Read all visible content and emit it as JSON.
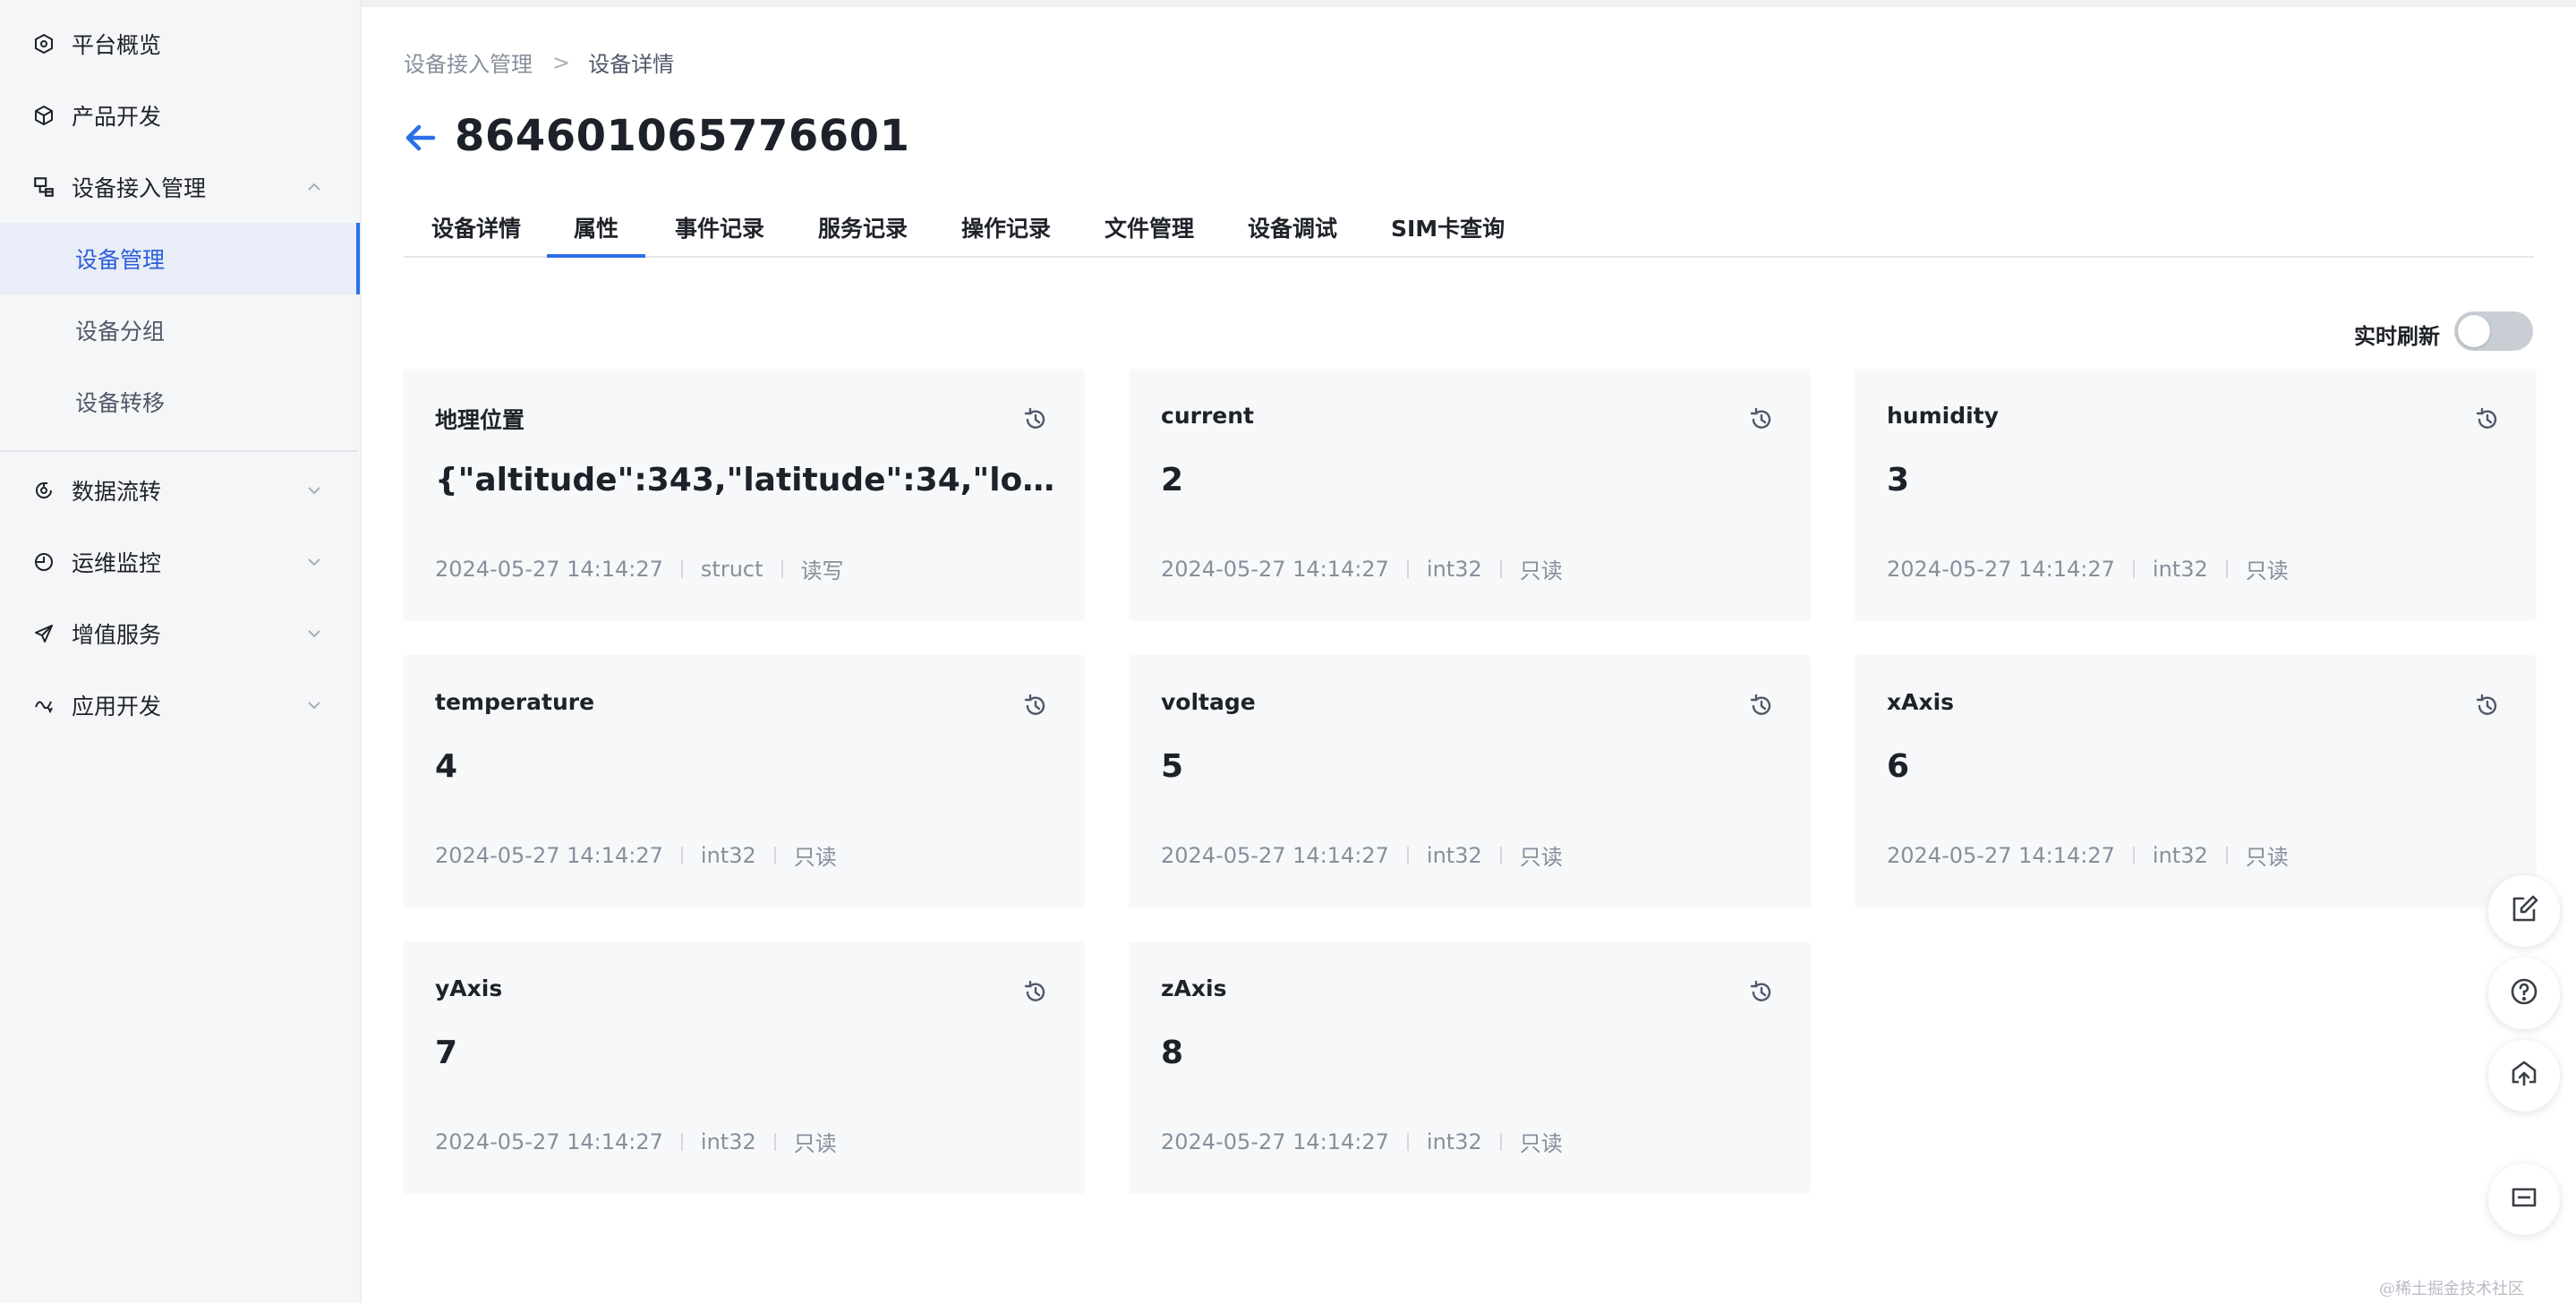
{
  "sidebar": {
    "items": [
      {
        "label": "平台概览",
        "icon": "hexagon-icon"
      },
      {
        "label": "产品开发",
        "icon": "cube-icon"
      },
      {
        "label": "设备接入管理",
        "icon": "device-link-icon",
        "expanded": true
      },
      {
        "label": "数据流转",
        "icon": "data-flow-icon"
      },
      {
        "label": "运维监控",
        "icon": "monitor-clock-icon"
      },
      {
        "label": "增值服务",
        "icon": "paper-plane-icon"
      },
      {
        "label": "应用开发",
        "icon": "app-dev-icon"
      }
    ],
    "sub_items": [
      {
        "label": "设备管理",
        "active": true
      },
      {
        "label": "设备分组"
      },
      {
        "label": "设备转移"
      }
    ]
  },
  "breadcrumb": {
    "parent": "设备接入管理",
    "separator": ">",
    "current": "设备详情"
  },
  "page": {
    "title": "864601065776601"
  },
  "tabs": [
    {
      "label": "设备详情"
    },
    {
      "label": "属性",
      "active": true
    },
    {
      "label": "事件记录"
    },
    {
      "label": "服务记录"
    },
    {
      "label": "操作记录"
    },
    {
      "label": "文件管理"
    },
    {
      "label": "设备调试"
    },
    {
      "label": "SIM卡查询"
    }
  ],
  "realtime_refresh": {
    "label": "实时刷新",
    "on": false
  },
  "properties": [
    {
      "name": "地理位置",
      "value": "{\"altitude\":343,\"latitude\":34,\"longitud...",
      "time": "2024-05-27 14:14:27",
      "type": "struct",
      "access": "读写"
    },
    {
      "name": "current",
      "value": "2",
      "time": "2024-05-27 14:14:27",
      "type": "int32",
      "access": "只读"
    },
    {
      "name": "humidity",
      "value": "3",
      "time": "2024-05-27 14:14:27",
      "type": "int32",
      "access": "只读"
    },
    {
      "name": "temperature",
      "value": "4",
      "time": "2024-05-27 14:14:27",
      "type": "int32",
      "access": "只读"
    },
    {
      "name": "voltage",
      "value": "5",
      "time": "2024-05-27 14:14:27",
      "type": "int32",
      "access": "只读"
    },
    {
      "name": "xAxis",
      "value": "6",
      "time": "2024-05-27 14:14:27",
      "type": "int32",
      "access": "只读"
    },
    {
      "name": "yAxis",
      "value": "7",
      "time": "2024-05-27 14:14:27",
      "type": "int32",
      "access": "只读"
    },
    {
      "name": "zAxis",
      "value": "8",
      "time": "2024-05-27 14:14:27",
      "type": "int32",
      "access": "只读"
    }
  ],
  "floating_buttons": [
    {
      "icon": "edit-icon"
    },
    {
      "icon": "help-icon"
    },
    {
      "icon": "cloud-upload-icon"
    },
    {
      "icon": "minimize-icon"
    }
  ],
  "watermark": "@稀土掘金技术社区",
  "colors": {
    "accent": "#2b6ee8",
    "sidebar_bg": "#f5f6f7",
    "card_bg": "#f7f8fa",
    "muted_text": "#86909c"
  }
}
